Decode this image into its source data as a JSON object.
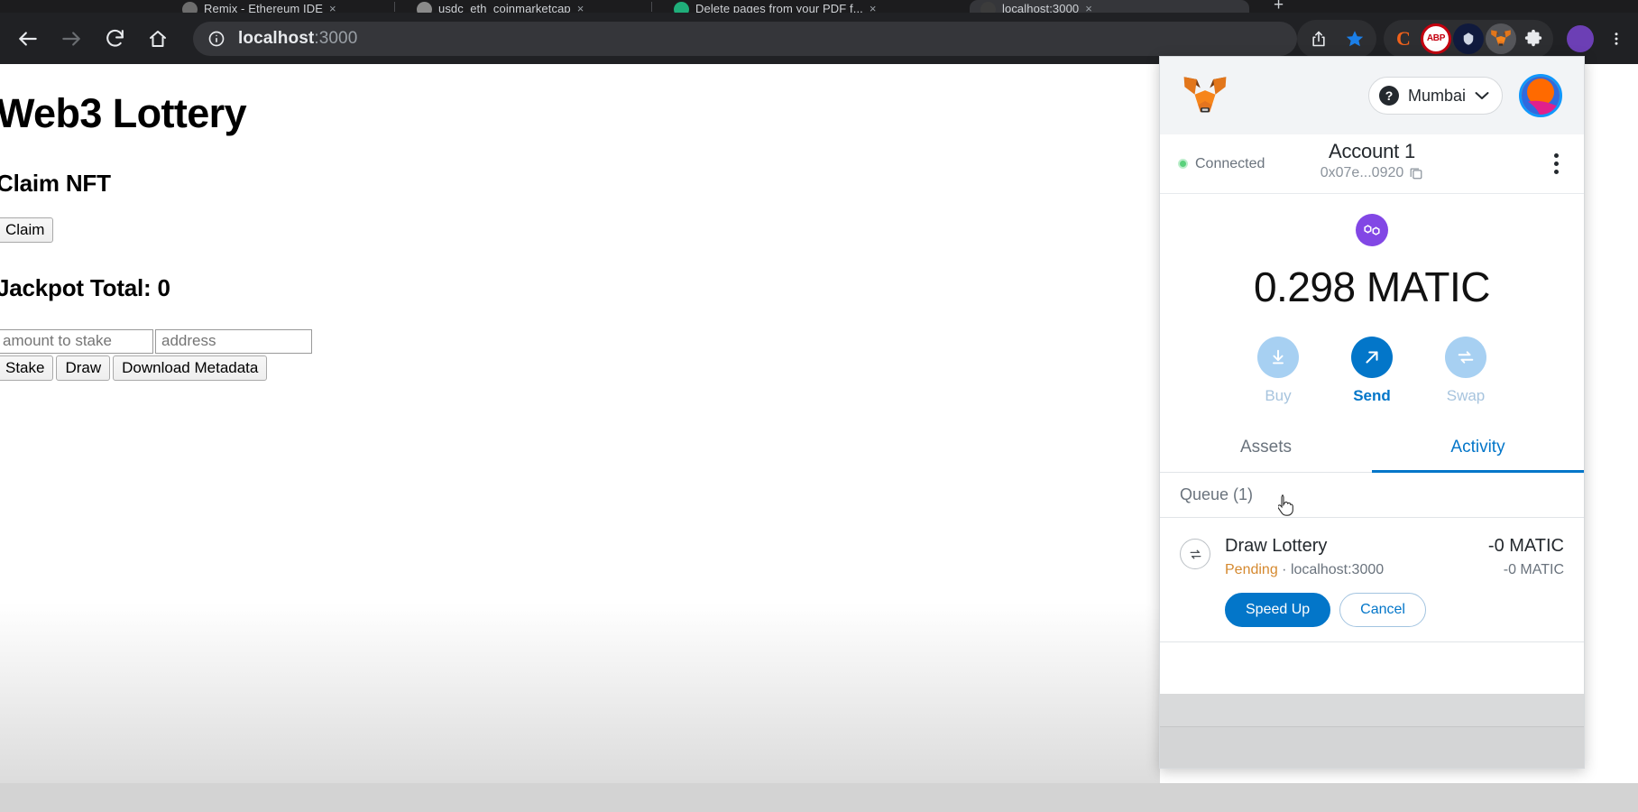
{
  "browser": {
    "tabs": [
      {
        "title": "Remix - Ethereum IDE",
        "close": "×",
        "active": false
      },
      {
        "title": "usdc_eth_coinmarketcap",
        "close": "×",
        "active": false
      },
      {
        "title": "Delete pages from your PDF f...",
        "close": "×",
        "active": false
      },
      {
        "title": "localhost:3000",
        "close": "×",
        "active": true
      }
    ],
    "nav": {
      "back": "back-arrow",
      "forward": "forward-arrow",
      "reload": "reload-icon",
      "home": "home-icon"
    },
    "omnibox": {
      "site_info_icon": "info-circle-icon",
      "url_host": "localhost",
      "url_port": ":3000"
    },
    "toolbar_actions": [
      {
        "name": "share-icon",
        "glyph": "share"
      },
      {
        "name": "bookmark-star-icon",
        "glyph": "star"
      }
    ],
    "extensions": [
      {
        "name": "extension-icon-c",
        "label": "C"
      },
      {
        "name": "extension-icon-adblock-plus",
        "label": "ABP"
      },
      {
        "name": "extension-icon-blue",
        "label": ""
      },
      {
        "name": "extension-icon-metamask",
        "label": "fox"
      },
      {
        "name": "extensions-puzzle-icon",
        "label": "puzzle"
      }
    ]
  },
  "page": {
    "title": "Web3 Lottery",
    "claim_heading": "Claim NFT",
    "claim_button": "Claim",
    "jackpot_heading": "Jackpot Total: 0",
    "stake_input_placeholder": "amount to stake",
    "stake_input_value": "",
    "address_input_placeholder": "address",
    "address_input_value": "",
    "buttons": [
      {
        "label": "Stake",
        "name": "stake-button"
      },
      {
        "label": "Draw",
        "name": "draw-button"
      },
      {
        "label": "Download Metadata",
        "name": "download-metadata-button"
      }
    ]
  },
  "metamask": {
    "logo": "metamask-fox-logo",
    "network": {
      "name": "Mumbai",
      "icon": "unknown-network-question-icon",
      "chevron": "chevron-down-icon"
    },
    "account": {
      "connection_status": "Connected",
      "name": "Account 1",
      "address": "0x07e...0920",
      "copy_icon": "copy-icon",
      "menu_icon": "kebab-menu-icon",
      "avatar": "account-avatar"
    },
    "balance": {
      "token_logo": "polygon-matic-logo",
      "amount": "0.298",
      "symbol": "MATIC",
      "display": "0.298 MATIC"
    },
    "actions": [
      {
        "label": "Buy",
        "name": "buy-button",
        "icon": "download-arrow-icon",
        "state": "muted"
      },
      {
        "label": "Send",
        "name": "send-button",
        "icon": "arrow-up-right-icon",
        "state": "primary"
      },
      {
        "label": "Swap",
        "name": "swap-button",
        "icon": "swap-arrows-icon",
        "state": "muted"
      }
    ],
    "tabs": [
      {
        "label": "Assets",
        "name": "tab-assets",
        "active": false
      },
      {
        "label": "Activity",
        "name": "tab-activity",
        "active": true
      }
    ],
    "queue_header": "Queue (1)",
    "transactions": [
      {
        "icon": "swap-arrows-icon",
        "title": "Draw Lottery",
        "amount": "-0 MATIC",
        "status": "Pending",
        "separator": "·",
        "origin": "localhost:3000",
        "fiat": "-0 MATIC",
        "speed_up_label": "Speed Up",
        "cancel_label": "Cancel"
      }
    ]
  },
  "colors": {
    "chrome_dark": "#202124",
    "mm_blue": "#0376c9",
    "mm_muted_blue": "#a7d0f2",
    "pending_orange": "#d5892f",
    "connected_green": "#5ad17c",
    "polygon_purple": "#8247e5"
  }
}
